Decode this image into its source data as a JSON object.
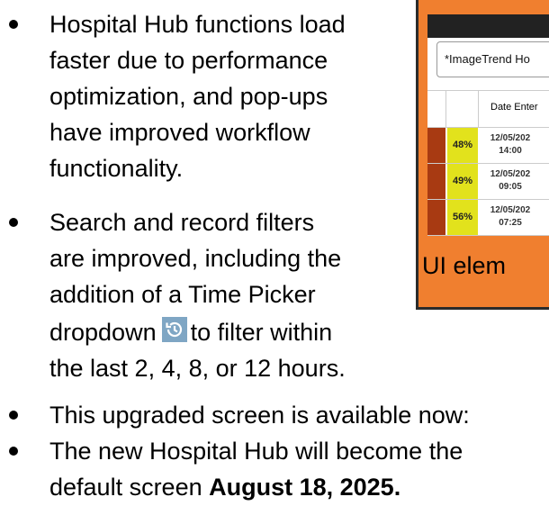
{
  "bullets": [
    {
      "lines": [
        "Hospital Hub functions load",
        "faster due to performance",
        "optimization, and pop-ups",
        "have improved workflow",
        "functionality."
      ]
    },
    {
      "lines": [
        "Search and record filters",
        "are improved, including the",
        "addition of a Time Picker"
      ],
      "line4_before": "dropdown",
      "line4_after": "to filter within",
      "line5": "the last 2, 4, 8, or 12 hours."
    },
    {
      "lines": [
        "This upgraded screen is available now:"
      ]
    },
    {
      "line1": "The new Hospital Hub will become the",
      "line2_before": "default screen ",
      "line2_bold": "August 18, 2025."
    }
  ],
  "icons": {
    "time_picker": "time-picker-history-icon"
  },
  "screenshot": {
    "search_text": "*ImageTrend Ho",
    "column_header": "Date Enter",
    "rows": [
      {
        "pct": "48%",
        "date_line1": "12/05/202",
        "date_line2": "14:00"
      },
      {
        "pct": "49%",
        "date_line1": "12/05/202",
        "date_line2": "09:05"
      },
      {
        "pct": "56%",
        "date_line1": "12/05/202",
        "date_line2": "07:25"
      }
    ],
    "caption": "UI elem"
  },
  "colors": {
    "panel_orange": "#f07f2f",
    "status_red": "#a83a12",
    "pct_yellow": "#e2e21c",
    "icon_blue": "#7fa6c4"
  }
}
